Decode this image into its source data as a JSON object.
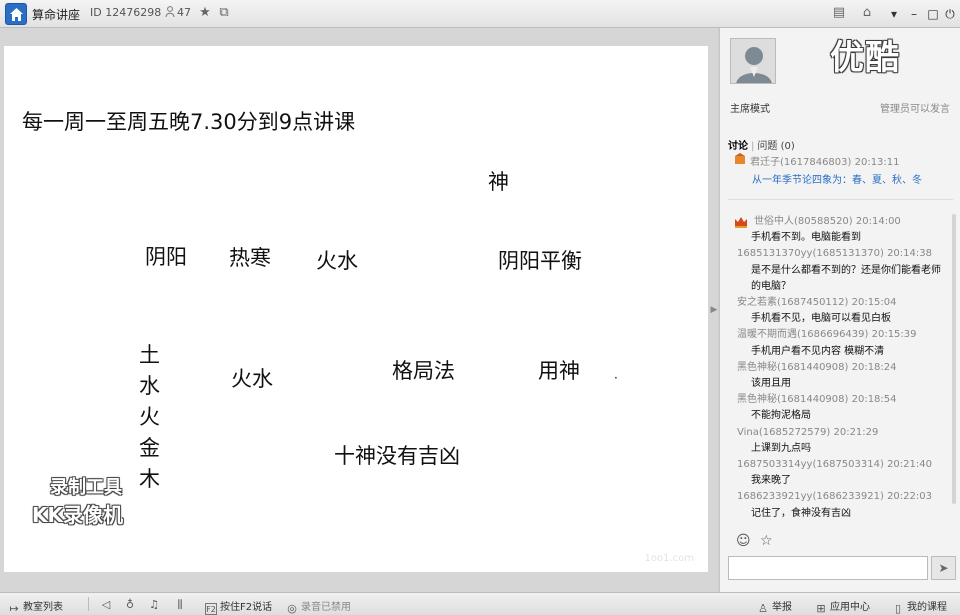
{
  "titlebar": {
    "room_name": "算命讲座",
    "room_id": "ID 12476298",
    "online_count": "47",
    "icons": [
      "home-icon",
      "user-icon",
      "star-icon",
      "share-icon",
      "menu-icon",
      "skin-icon",
      "minimize-icon",
      "maximize-icon",
      "power-icon"
    ]
  },
  "board": {
    "headline": "每一周一至周五晚7.30分到9点讲课",
    "words": {
      "shen": "神",
      "yinyang": "阴阳",
      "rehan": "热寒",
      "huoshui1": "火水",
      "yinyang_pingheng": "阴阳平衡",
      "huoshui2": "火水",
      "geju": "格局法",
      "yongshen": "用神",
      "shishen": "十神没有吉凶"
    },
    "vertical": [
      "土",
      "水",
      "火",
      "金",
      "木"
    ],
    "watermark": {
      "line1": "录制工具",
      "line2": "KK录像机"
    },
    "faint_mark": "1oo1.com"
  },
  "sidebar": {
    "logo": "优酷",
    "mode": "主席模式",
    "admin_note": "管理员可以发言",
    "tabs": {
      "discuss": "讨论",
      "question": "问题",
      "question_count": "(0)"
    },
    "pinned": {
      "sender": "君迁子(1617846803) 20:13:11",
      "message": "从一年季节论四象为：春、夏、秋、冬"
    },
    "messages": [
      {
        "sender": "世俗中人(80588520) 20:14:00",
        "text": "手机看不到。电脑能看到"
      },
      {
        "sender": "1685131370yy(1685131370) 20:14:38",
        "text": "是不是什么都看不到的？还是你们能看老师的电脑？"
      },
      {
        "sender": "安之若素(1687450112) 20:15:04",
        "text": "手机看不见，电脑可以看见白板"
      },
      {
        "sender": "温暖不期而遇(1686696439) 20:15:39",
        "text": "手机用户看不见内容 模糊不清"
      },
      {
        "sender": "黑色神秘(1681440908) 20:18:24",
        "text": "该用且用"
      },
      {
        "sender": "黑色神秘(1681440908) 20:18:54",
        "text": "不能拘泥格局"
      },
      {
        "sender": "Vina(1685272579) 20:21:29",
        "text": "上课到九点吗"
      },
      {
        "sender": "1687503314yy(1687503314) 20:21:40",
        "text": "我来晚了"
      },
      {
        "sender": "1686233921yy(1686233921) 20:22:03",
        "text": "记住了，食神没有吉凶"
      }
    ],
    "input_value": ""
  },
  "bottombar": {
    "classroom_list": "教室列表",
    "press_f2": "按住F2说话",
    "recording_disabled": "录音已禁用",
    "report": "举报",
    "app_center": "应用中心",
    "my_courses": "我的课程"
  },
  "colors": {
    "accent": "#2a6fc4",
    "board_bg": "#ffffff",
    "panel_bg": "#f3f3f3"
  }
}
